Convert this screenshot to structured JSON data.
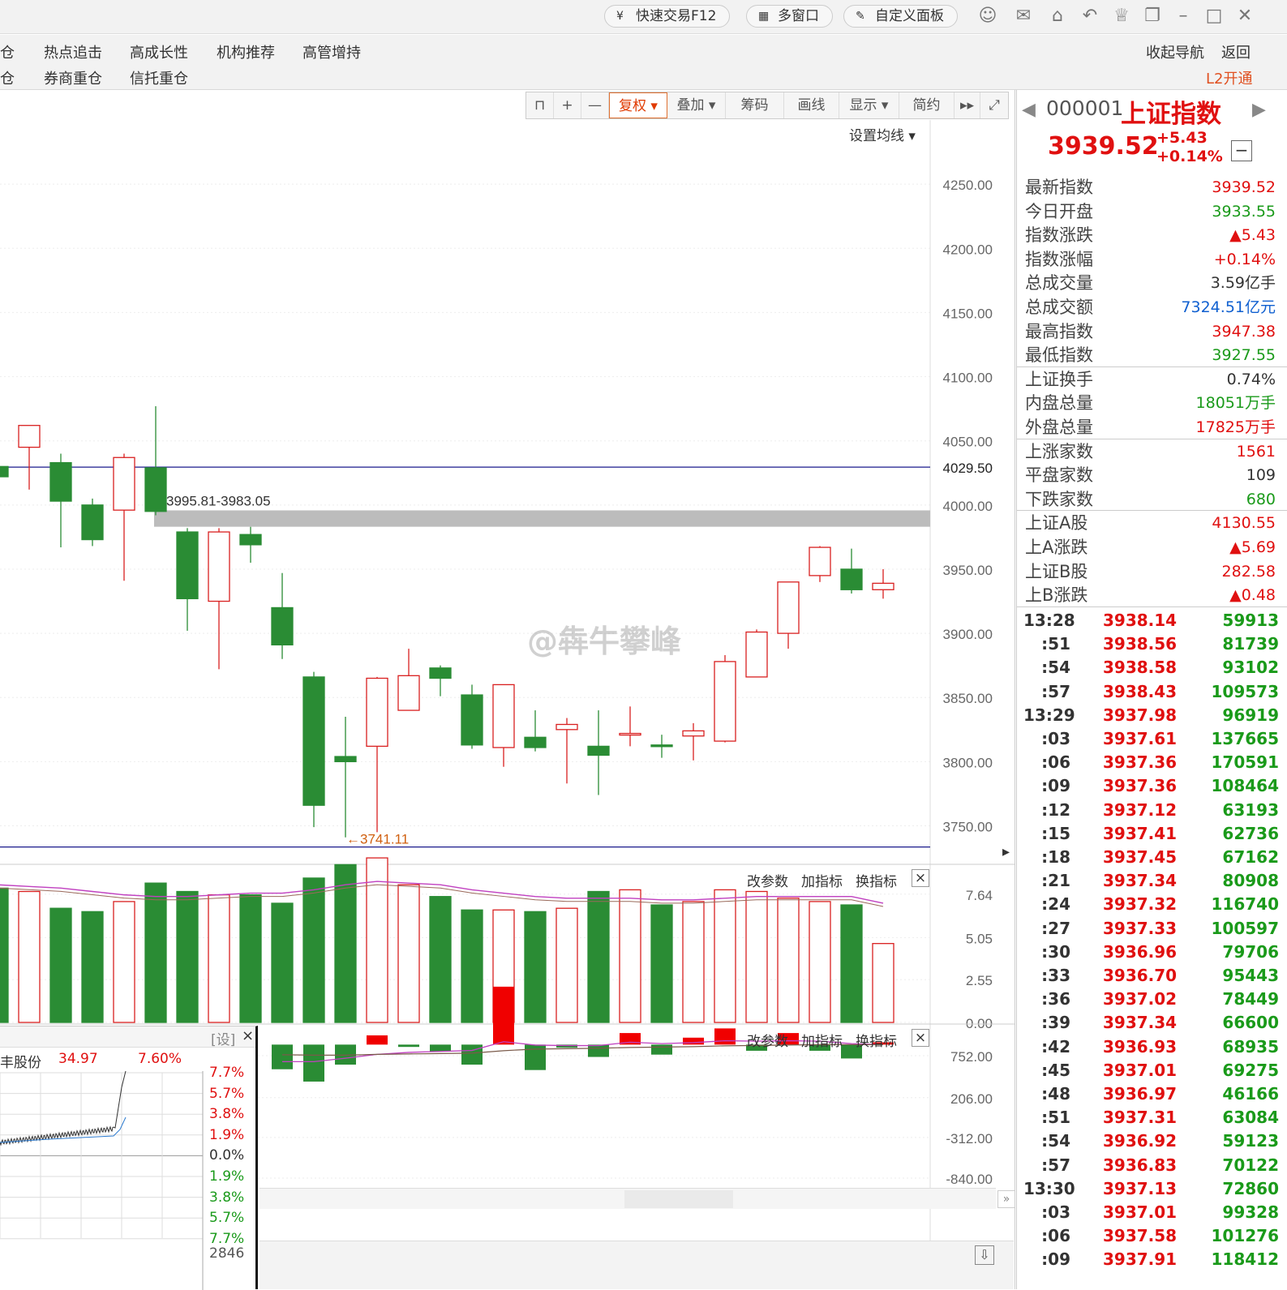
{
  "titlebar": {
    "buttons": [
      "快速交易F12",
      "多窗口",
      "自定义面板"
    ]
  },
  "nav": {
    "row1": [
      "仓",
      "热点追击",
      "高成长性",
      "机构推荐",
      "高管增持"
    ],
    "row2": [
      "仓",
      "券商重仓",
      "信托重仓"
    ],
    "right1": [
      "收起导航",
      "返回"
    ],
    "right2": "L2开通"
  },
  "toolbar": {
    "items": [
      "复权",
      "叠加",
      "筹码",
      "画线",
      "显示",
      "简约"
    ],
    "ma_setting": "设置均线"
  },
  "kline": {
    "y_ticks": [
      "4250.00",
      "4200.00",
      "4150.00",
      "4100.00",
      "4050.00",
      "4000.00",
      "3950.00",
      "3900.00",
      "3850.00",
      "3800.00",
      "3750.00"
    ],
    "hline_label": "4029.50",
    "band_label": "3995.81-3983.05",
    "low_label": "←3741.11"
  },
  "volume_panel": {
    "controls": [
      "改参数",
      "加指标",
      "换指标"
    ],
    "y_ticks": [
      "7.64",
      "5.05",
      "2.55",
      "0.00"
    ]
  },
  "macd_panel": {
    "controls": [
      "改参数",
      "加指标",
      "换指标"
    ],
    "y_ticks": [
      "752.00",
      "206.00",
      "-312.00",
      "-840.00"
    ]
  },
  "mini": {
    "set": "[设]",
    "close": "×",
    "name": "丰股份",
    "price": "34.97",
    "pct": "7.60%",
    "scale": [
      "7.7%",
      "5.7%",
      "3.8%",
      "1.9%",
      "0.0%",
      "1.9%",
      "3.8%",
      "5.7%",
      "7.7%"
    ],
    "bottom": "2846"
  },
  "quote": {
    "code": "000001",
    "name": "上证指数",
    "price": "3939.52",
    "change": "+5.43",
    "change_pct": "+0.14%",
    "rows": [
      {
        "k": "最新指数",
        "v": "3939.52",
        "c": "red"
      },
      {
        "k": "今日开盘",
        "v": "3933.55",
        "c": "green"
      },
      {
        "k": "指数涨跌",
        "v": "▲5.43",
        "c": "red"
      },
      {
        "k": "指数涨幅",
        "v": "+0.14%",
        "c": "red"
      },
      {
        "k": "总成交量",
        "v": "3.59亿手",
        "c": "black"
      },
      {
        "k": "总成交额",
        "v": "7324.51亿元",
        "c": "blue"
      },
      {
        "k": "最高指数",
        "v": "3947.38",
        "c": "red"
      },
      {
        "k": "最低指数",
        "v": "3927.55",
        "c": "green"
      },
      {
        "k": "上证换手",
        "v": "0.74%",
        "c": "black"
      },
      {
        "k": "内盘总量",
        "v": "18051万手",
        "c": "green"
      },
      {
        "k": "外盘总量",
        "v": "17825万手",
        "c": "red"
      },
      {
        "k": "上涨家数",
        "v": "1561",
        "c": "red"
      },
      {
        "k": "平盘家数",
        "v": "109",
        "c": "black"
      },
      {
        "k": "下跌家数",
        "v": "680",
        "c": "green"
      },
      {
        "k": "上证A股",
        "v": "4130.55",
        "c": "red"
      },
      {
        "k": "上A涨跌",
        "v": "▲5.69",
        "c": "red"
      },
      {
        "k": "上证B股",
        "v": "282.58",
        "c": "red"
      },
      {
        "k": "上B涨跌",
        "v": "▲0.48",
        "c": "red"
      }
    ],
    "ticks": [
      {
        "t": "13:28",
        "p": "3938.14",
        "v": "59913"
      },
      {
        "t": ":51",
        "p": "3938.56",
        "v": "81739"
      },
      {
        "t": ":54",
        "p": "3938.58",
        "v": "93102"
      },
      {
        "t": ":57",
        "p": "3938.43",
        "v": "109573"
      },
      {
        "t": "13:29",
        "p": "3937.98",
        "v": "96919"
      },
      {
        "t": ":03",
        "p": "3937.61",
        "v": "137665"
      },
      {
        "t": ":06",
        "p": "3937.36",
        "v": "170591"
      },
      {
        "t": ":09",
        "p": "3937.36",
        "v": "108464"
      },
      {
        "t": ":12",
        "p": "3937.12",
        "v": "63193"
      },
      {
        "t": ":15",
        "p": "3937.41",
        "v": "62736"
      },
      {
        "t": ":18",
        "p": "3937.45",
        "v": "67162"
      },
      {
        "t": ":21",
        "p": "3937.34",
        "v": "80908"
      },
      {
        "t": ":24",
        "p": "3937.32",
        "v": "116740"
      },
      {
        "t": ":27",
        "p": "3937.33",
        "v": "100597"
      },
      {
        "t": ":30",
        "p": "3936.96",
        "v": "79706"
      },
      {
        "t": ":33",
        "p": "3936.70",
        "v": "95443"
      },
      {
        "t": ":36",
        "p": "3937.02",
        "v": "78449"
      },
      {
        "t": ":39",
        "p": "3937.34",
        "v": "66600"
      },
      {
        "t": ":42",
        "p": "3936.93",
        "v": "68935"
      },
      {
        "t": ":45",
        "p": "3937.01",
        "v": "69275"
      },
      {
        "t": ":48",
        "p": "3936.97",
        "v": "46166"
      },
      {
        "t": ":51",
        "p": "3937.31",
        "v": "63084"
      },
      {
        "t": ":54",
        "p": "3936.92",
        "v": "59123"
      },
      {
        "t": ":57",
        "p": "3936.83",
        "v": "70122"
      },
      {
        "t": "13:30",
        "p": "3937.13",
        "v": "72860"
      },
      {
        "t": ":03",
        "p": "3937.01",
        "v": "99328"
      },
      {
        "t": ":06",
        "p": "3937.58",
        "v": "101276"
      },
      {
        "t": ":09",
        "p": "3937.91",
        "v": "118412"
      }
    ]
  },
  "watermark": "@犇牛攀峰",
  "chart_data": {
    "type": "candlestick",
    "candles": [
      {
        "o": 4030,
        "h": 4035,
        "l": 4020,
        "c": 4022
      },
      {
        "o": 4045,
        "h": 4060,
        "l": 4012,
        "c": 4062
      },
      {
        "o": 4033,
        "h": 4040,
        "l": 3967,
        "c": 4003
      },
      {
        "o": 4000,
        "h": 4005,
        "l": 3968,
        "c": 3973
      },
      {
        "o": 3996,
        "h": 4040,
        "l": 3941,
        "c": 4037
      },
      {
        "o": 4029,
        "h": 4077,
        "l": 3992,
        "c": 3995
      },
      {
        "o": 3979,
        "h": 3982,
        "l": 3902,
        "c": 3927
      },
      {
        "o": 3925,
        "h": 3982,
        "l": 3872,
        "c": 3979
      },
      {
        "o": 3977,
        "h": 3983,
        "l": 3955,
        "c": 3969
      },
      {
        "o": 3920,
        "h": 3947,
        "l": 3880,
        "c": 3891
      },
      {
        "o": 3866,
        "h": 3870,
        "l": 3749,
        "c": 3766
      },
      {
        "o": 3804,
        "h": 3835,
        "l": 3741,
        "c": 3800
      },
      {
        "o": 3812,
        "h": 3866,
        "l": 3745,
        "c": 3865
      },
      {
        "o": 3840,
        "h": 3888,
        "l": 3840,
        "c": 3867
      },
      {
        "o": 3873,
        "h": 3875,
        "l": 3851,
        "c": 3865
      },
      {
        "o": 3852,
        "h": 3860,
        "l": 3810,
        "c": 3813
      },
      {
        "o": 3811,
        "h": 3860,
        "l": 3796,
        "c": 3860
      },
      {
        "o": 3819,
        "h": 3840,
        "l": 3808,
        "c": 3811
      },
      {
        "o": 3825,
        "h": 3834,
        "l": 3783,
        "c": 3829
      },
      {
        "o": 3812,
        "h": 3840,
        "l": 3774,
        "c": 3805
      },
      {
        "o": 3822,
        "h": 3843,
        "l": 3812,
        "c": 3822
      },
      {
        "o": 3813,
        "h": 3821,
        "l": 3803,
        "c": 3812
      },
      {
        "o": 3820,
        "h": 3830,
        "l": 3801,
        "c": 3824
      },
      {
        "o": 3816,
        "h": 3883,
        "l": 3815,
        "c": 3878
      },
      {
        "o": 3866,
        "h": 3903,
        "l": 3866,
        "c": 3901
      },
      {
        "o": 3900,
        "h": 3940,
        "l": 3888,
        "c": 3940
      },
      {
        "o": 3945,
        "h": 3968,
        "l": 3940,
        "c": 3967
      },
      {
        "o": 3950,
        "h": 3966,
        "l": 3931,
        "c": 3934
      },
      {
        "o": 3934,
        "h": 3950,
        "l": 3927,
        "c": 3939
      }
    ],
    "ylim": [
      3720,
      4300
    ],
    "hlines": [
      4029.5,
      3741.11
    ],
    "band": [
      3983.05,
      3995.81
    ],
    "volume": {
      "ylim": [
        0,
        8.5
      ],
      "values": [
        8.0,
        7.8,
        6.8,
        6.6,
        7.2,
        8.3,
        7.8,
        7.6,
        7.6,
        7.1,
        8.6,
        9.4,
        9.8,
        8.2,
        7.5,
        6.7,
        6.7,
        6.6,
        6.8,
        7.8,
        7.9,
        7.0,
        7.2,
        7.9,
        7.8,
        7.4,
        7.2,
        7.0,
        4.7
      ],
      "ma": [
        8.2,
        8.1,
        8.0,
        7.8,
        7.6,
        7.5,
        7.5,
        7.6,
        7.7,
        7.7,
        7.9,
        8.2,
        8.4,
        8.3,
        8.2,
        7.9,
        7.7,
        7.5,
        7.4,
        7.4,
        7.4,
        7.3,
        7.3,
        7.4,
        7.5,
        7.5,
        7.5,
        7.5,
        7.1
      ]
    },
    "macd": {
      "ylim": [
        -840,
        900
      ],
      "values": [
        0,
        0,
        0,
        0,
        0,
        0,
        0,
        0,
        -150,
        -320,
        -480,
        -260,
        120,
        -30,
        -90,
        -260,
        752,
        -330,
        -40,
        -160,
        150,
        -130,
        90,
        210,
        -80,
        150,
        -80,
        -180,
        30
      ],
      "dif": [
        -20,
        -60,
        -100,
        -140,
        -200,
        -240,
        -280,
        -310,
        -330,
        -350,
        -350,
        -280,
        -200,
        -160,
        -140,
        -120,
        60,
        -10,
        -20,
        -20,
        50,
        20,
        40,
        80,
        70,
        80,
        70,
        20,
        0
      ],
      "dea": [
        -10,
        -30,
        -60,
        -90,
        -120,
        -150,
        -180,
        -210,
        -230,
        -250,
        -260,
        -260,
        -240,
        -230,
        -220,
        -210,
        -150,
        -110,
        -100,
        -90,
        -70,
        -60,
        -50,
        -30,
        -20,
        -10,
        0,
        0,
        0
      ]
    }
  }
}
